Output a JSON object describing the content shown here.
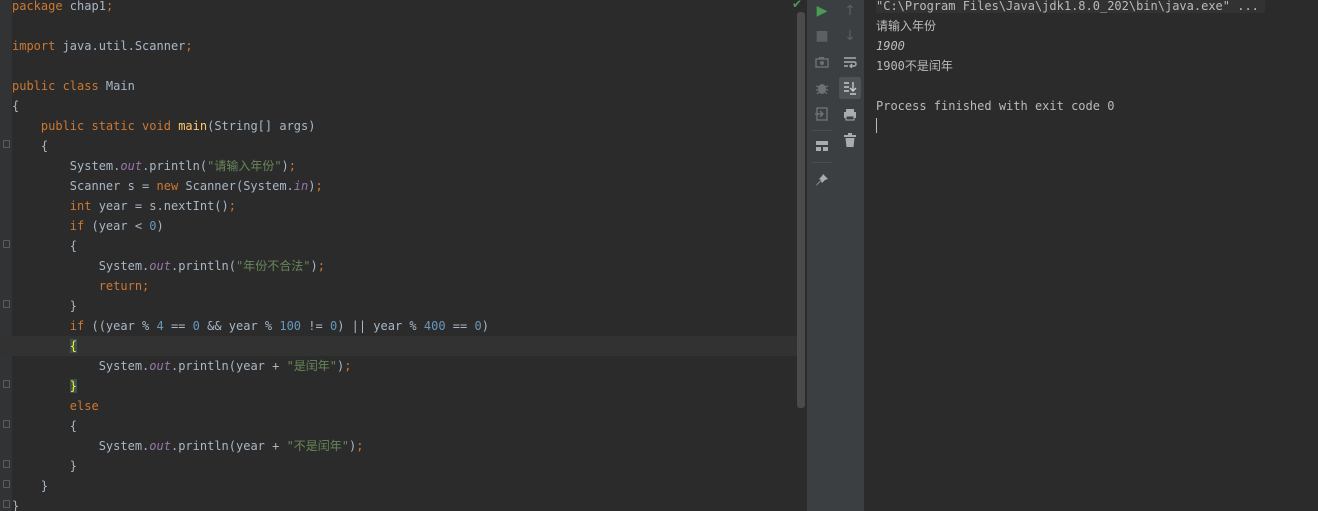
{
  "editor": {
    "lines": [
      [
        {
          "t": "package",
          "c": "kw"
        },
        {
          "t": " chap1",
          "c": ""
        },
        {
          "t": ";",
          "c": "kw"
        }
      ],
      [],
      [
        {
          "t": "import",
          "c": "kw"
        },
        {
          "t": " java.util.Scanner",
          "c": ""
        },
        {
          "t": ";",
          "c": "kw"
        }
      ],
      [],
      [
        {
          "t": "public class",
          "c": "kw"
        },
        {
          "t": " Main",
          "c": ""
        }
      ],
      [
        {
          "t": "{",
          "c": ""
        }
      ],
      [
        {
          "t": "    "
        },
        {
          "t": "public static void",
          "c": "kw"
        },
        {
          "t": " "
        },
        {
          "t": "main",
          "c": "fn"
        },
        {
          "t": "(String[] args)",
          "c": ""
        }
      ],
      [
        {
          "t": "    {",
          "c": ""
        }
      ],
      [
        {
          "t": "        System."
        },
        {
          "t": "out",
          "c": "fld"
        },
        {
          "t": ".println("
        },
        {
          "t": "\"请输入年份\"",
          "c": "str"
        },
        {
          "t": ")"
        },
        {
          "t": ";",
          "c": "kw"
        }
      ],
      [
        {
          "t": "        Scanner s = "
        },
        {
          "t": "new",
          "c": "kw"
        },
        {
          "t": " Scanner(System."
        },
        {
          "t": "in",
          "c": "fld"
        },
        {
          "t": ")"
        },
        {
          "t": ";",
          "c": "kw"
        }
      ],
      [
        {
          "t": "        "
        },
        {
          "t": "int",
          "c": "kw"
        },
        {
          "t": " year = s.nextInt()"
        },
        {
          "t": ";",
          "c": "kw"
        }
      ],
      [
        {
          "t": "        "
        },
        {
          "t": "if",
          "c": "kw"
        },
        {
          "t": " (year < "
        },
        {
          "t": "0",
          "c": "num"
        },
        {
          "t": ")"
        }
      ],
      [
        {
          "t": "        {"
        }
      ],
      [
        {
          "t": "            System."
        },
        {
          "t": "out",
          "c": "fld"
        },
        {
          "t": ".println("
        },
        {
          "t": "\"年份不合法\"",
          "c": "str"
        },
        {
          "t": ")"
        },
        {
          "t": ";",
          "c": "kw"
        }
      ],
      [
        {
          "t": "            "
        },
        {
          "t": "return;",
          "c": "kw"
        }
      ],
      [
        {
          "t": "        }"
        }
      ],
      [
        {
          "t": "        "
        },
        {
          "t": "if",
          "c": "kw"
        },
        {
          "t": " ((year % "
        },
        {
          "t": "4",
          "c": "num"
        },
        {
          "t": " == "
        },
        {
          "t": "0",
          "c": "num"
        },
        {
          "t": " && year % "
        },
        {
          "t": "100",
          "c": "num"
        },
        {
          "t": " != "
        },
        {
          "t": "0",
          "c": "num"
        },
        {
          "t": ") || year % "
        },
        {
          "t": "400",
          "c": "num"
        },
        {
          "t": " == "
        },
        {
          "t": "0",
          "c": "num"
        },
        {
          "t": ")"
        }
      ],
      [
        {
          "t": "        "
        },
        {
          "t": "{",
          "c": "brace-match"
        }
      ],
      [
        {
          "t": "            System."
        },
        {
          "t": "out",
          "c": "fld"
        },
        {
          "t": ".println(year + "
        },
        {
          "t": "\"是闰年\"",
          "c": "str"
        },
        {
          "t": ")"
        },
        {
          "t": ";",
          "c": "kw"
        }
      ],
      [
        {
          "t": "        "
        },
        {
          "t": "}",
          "c": "brace-match"
        }
      ],
      [
        {
          "t": "        "
        },
        {
          "t": "else",
          "c": "kw"
        }
      ],
      [
        {
          "t": "        {"
        }
      ],
      [
        {
          "t": "            System."
        },
        {
          "t": "out",
          "c": "fld"
        },
        {
          "t": ".println(year + "
        },
        {
          "t": "\"不是闰年\"",
          "c": "str"
        },
        {
          "t": ")"
        },
        {
          "t": ";",
          "c": "kw"
        }
      ],
      [
        {
          "t": "        }"
        }
      ],
      [
        {
          "t": "    }"
        }
      ],
      [
        {
          "t": "}"
        }
      ]
    ],
    "current_line_index": 17
  },
  "run_toolbar": {
    "rerun_icon": "play-icon",
    "stop_icon": "stop-icon",
    "dump_threads_icon": "camera-icon",
    "debug_icon": "bug-icon",
    "exit_icon": "exit-icon",
    "layout_icon": "layout-icon",
    "pin_icon": "pin-icon",
    "up_icon": "arrow-up-icon",
    "down_icon": "arrow-down-icon",
    "wrap_icon": "soft-wrap-icon",
    "scroll_end_icon": "scroll-to-end-icon",
    "print_icon": "print-icon",
    "clear_icon": "trash-icon"
  },
  "console": {
    "command": "\"C:\\Program Files\\Java\\jdk1.8.0_202\\bin\\java.exe\" ...",
    "prompt_output": "请输入年份",
    "user_input": "1900",
    "result_output": "1900不是闰年",
    "exit_message": "Process finished with exit code 0"
  },
  "colors": {
    "keyword": "#cc7832",
    "string": "#6a8759",
    "number": "#6897bb",
    "field": "#9876aa",
    "method": "#ffc66d",
    "input": "#499c54"
  }
}
